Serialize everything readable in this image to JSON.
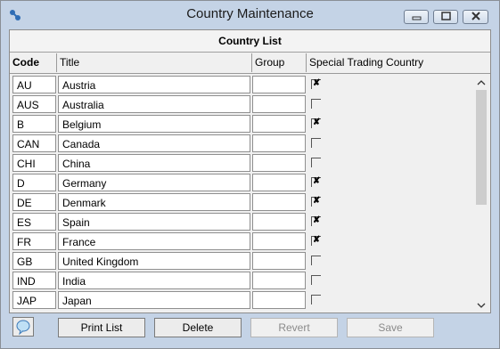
{
  "window": {
    "title": "Country Maintenance"
  },
  "table": {
    "caption": "Country List",
    "columns": {
      "code": "Code",
      "title": "Title",
      "group": "Group",
      "special": "Special Trading Country"
    },
    "rows": [
      {
        "code": "AU",
        "title": "Austria",
        "group": "",
        "special": true
      },
      {
        "code": "AUS",
        "title": "Australia",
        "group": "",
        "special": false
      },
      {
        "code": "B",
        "title": "Belgium",
        "group": "",
        "special": true
      },
      {
        "code": "CAN",
        "title": "Canada",
        "group": "",
        "special": false
      },
      {
        "code": "CHI",
        "title": "China",
        "group": "",
        "special": false
      },
      {
        "code": "D",
        "title": "Germany",
        "group": "",
        "special": true
      },
      {
        "code": "DE",
        "title": "Denmark",
        "group": "",
        "special": true
      },
      {
        "code": "ES",
        "title": "Spain",
        "group": "",
        "special": true
      },
      {
        "code": "FR",
        "title": "France",
        "group": "",
        "special": true
      },
      {
        "code": "GB",
        "title": "United Kingdom",
        "group": "",
        "special": false
      },
      {
        "code": "IND",
        "title": "India",
        "group": "",
        "special": false
      },
      {
        "code": "JAP",
        "title": "Japan",
        "group": "",
        "special": false
      }
    ]
  },
  "buttons": {
    "print_list": "Print List",
    "delete": "Delete",
    "revert": "Revert",
    "save": "Save"
  },
  "icons": {
    "app": "app-icon",
    "help": "help-bubble-icon",
    "check_mark": "✘"
  },
  "colors": {
    "titlebar": "#c4d3e6",
    "panel": "#f0f0f0"
  }
}
